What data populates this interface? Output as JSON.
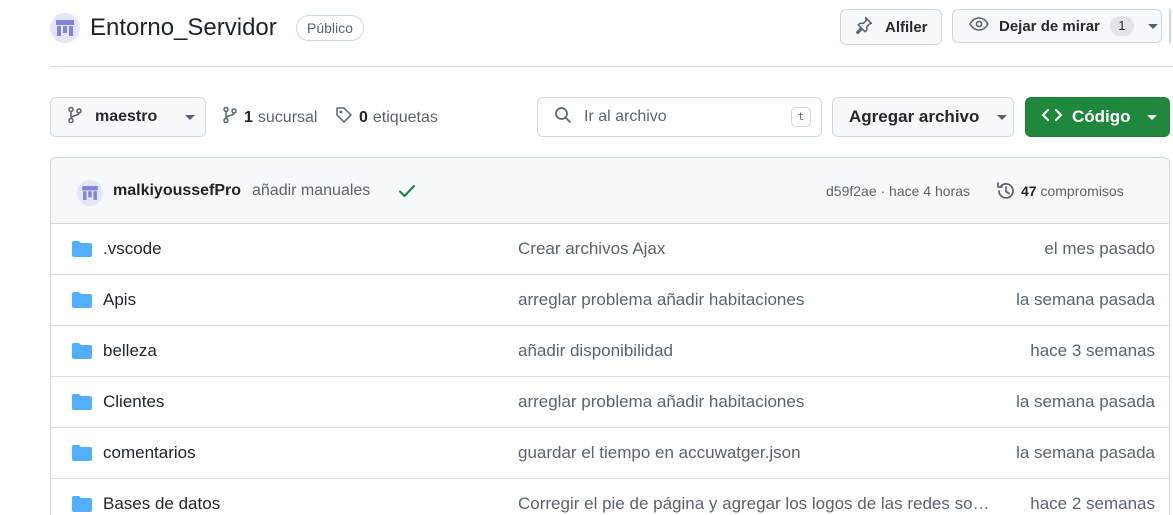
{
  "repo": {
    "name": "Entorno_Servidor",
    "visibility": "Público",
    "pin_label": "Alfiler",
    "watch_label": "Dejar de mirar",
    "watch_count": "1"
  },
  "toolbar": {
    "branch": "maestro",
    "branches_count": "1",
    "branches_label": "sucursal",
    "tags_count": "0",
    "tags_label": "etiquetas",
    "search_placeholder": "Ir al archivo",
    "search_shortcut": "t",
    "add_file_label": "Agregar archivo",
    "code_label": "Código"
  },
  "latest_commit": {
    "author": "malkiyoussefPro",
    "message": "añadir manuales",
    "status": "success",
    "meta": "d59f2ae · hace 4 horas",
    "commits_count": "47",
    "commits_label": "compromisos"
  },
  "files": [
    {
      "name": ".vscode",
      "commit": "Crear archivos Ajax",
      "age": "el mes pasado"
    },
    {
      "name": "Apis",
      "commit": "arreglar problema añadir habitaciones",
      "age": "la semana pasada"
    },
    {
      "name": "belleza",
      "commit": "añadir disponibilidad",
      "age": "hace 3 semanas"
    },
    {
      "name": "Clientes",
      "commit": "arreglar problema añadir habitaciones",
      "age": "la semana pasada"
    },
    {
      "name": "comentarios",
      "commit": "guardar el tiempo en accuwatger.json",
      "age": "la semana pasada"
    },
    {
      "name": "Bases de datos",
      "commit": "Corregir el pie de página y agregar los logos de las redes sociales",
      "age": "hace 2 semanas"
    }
  ],
  "colors": {
    "accent_green": "#1f883d",
    "folder_blue": "#54aeff",
    "check_green": "#1a7f37"
  },
  "icons": [
    "repo-avatar",
    "pin-icon",
    "eye-icon",
    "branch-icon",
    "tag-icon",
    "search-icon",
    "code-icon",
    "check-icon",
    "history-icon",
    "folder-icon"
  ]
}
